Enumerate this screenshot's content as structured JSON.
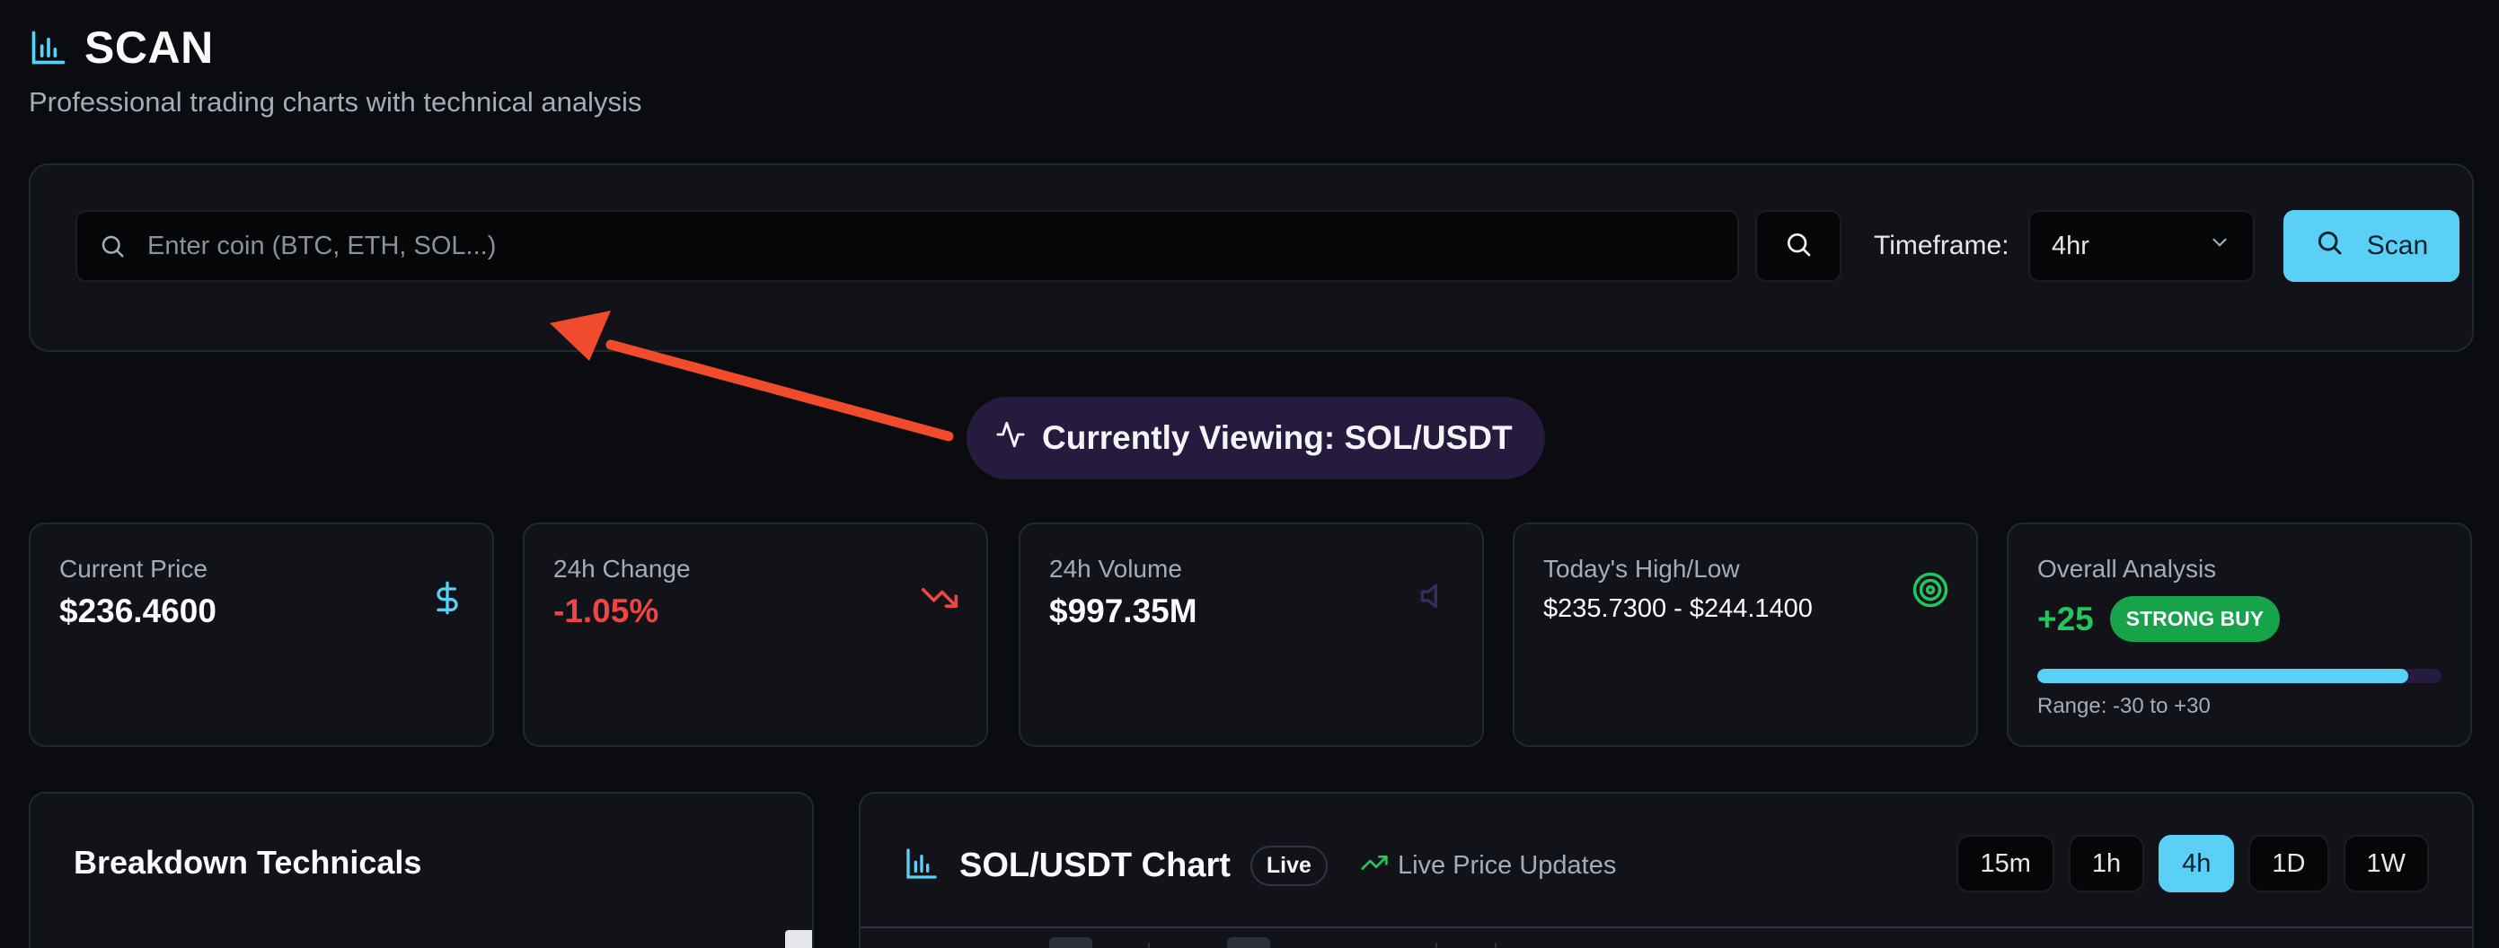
{
  "header": {
    "title": "SCAN",
    "subtitle": "Professional trading charts with technical analysis"
  },
  "search": {
    "placeholder": "Enter coin (BTC, ETH, SOL...)",
    "value": "",
    "timeframe_label": "Timeframe:",
    "timeframe_value": "4hr",
    "scan_label": "Scan"
  },
  "viewing": {
    "label": "Currently Viewing: SOL/USDT"
  },
  "cards": {
    "price": {
      "label": "Current Price",
      "value": "$236.4600"
    },
    "change": {
      "label": "24h Change",
      "value": "-1.05%"
    },
    "volume": {
      "label": "24h Volume",
      "value": "$997.35M"
    },
    "highlow": {
      "label": "Today's High/Low",
      "value": "$235.7300 - $244.1400"
    },
    "analysis": {
      "label": "Overall Analysis",
      "score": "+25",
      "badge": "STRONG BUY",
      "range_label": "Range: -30 to +30",
      "score_fraction": 0.9167
    }
  },
  "breakdown": {
    "title": "Breakdown Technicals"
  },
  "chart": {
    "title": "SOL/USDT Chart",
    "live_badge": "Live",
    "live_updates": "Live Price Updates",
    "timeframes": [
      "15m",
      "1h",
      "4h",
      "1D",
      "1W"
    ],
    "active_timeframe": "4h"
  },
  "colors": {
    "accent": "#5ad0f7",
    "negative": "#ef4444",
    "positive": "#22c55e",
    "pill": "#261a3f",
    "annotation_arrow": "#f04b2c"
  },
  "icons": {
    "logo": "bar-chart-icon",
    "price": "dollar-icon",
    "change": "trending-down-icon",
    "volume": "volume-icon",
    "highlow": "target-icon",
    "viewing": "activity-icon"
  }
}
